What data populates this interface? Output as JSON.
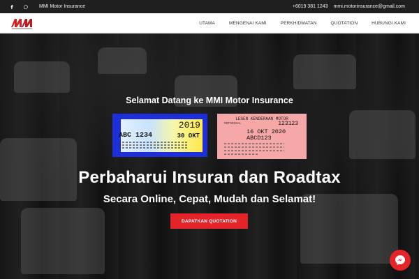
{
  "topbar": {
    "social": [
      {
        "icon": "facebook-icon"
      },
      {
        "icon": "whatsapp-icon"
      }
    ],
    "site_name": "MMI Motor Insurance",
    "phone": "+6019 381 1243",
    "email": "mmi.motorinsurance@gmail.com"
  },
  "navbar": {
    "logo_text": "MMI",
    "links": [
      "UTAMA",
      "MENGENAI KAMI",
      "PERKHIDMATAN",
      "QUOTATION",
      "HUBUNGI KAMI"
    ]
  },
  "hero": {
    "welcome": "Selamat Datang ke MMI Motor Insurance",
    "road_tax_sticker": {
      "year": "2019",
      "plate": "ABC 1234",
      "expiry": "30 OKT"
    },
    "licence_card": {
      "header": "LESEN KENDERAAN MOTOR",
      "type": "MOTOSIKAL",
      "number": "123123",
      "expiry": "16 OKT 2020",
      "registration": "ABCD123"
    },
    "headline": "Perbaharui Insuran dan Roadtax",
    "subheadline": "Secara Online, Cepat, Mudah dan Selamat!",
    "cta_label": "DAPATKAN QUOTATION"
  },
  "colors": {
    "accent": "#e52429",
    "topbar_bg": "#1f1f1f",
    "sticker_blue": "#1d2fd9",
    "licence_pink": "#f6a7a7"
  },
  "floating": {
    "icon": "messenger-icon"
  }
}
